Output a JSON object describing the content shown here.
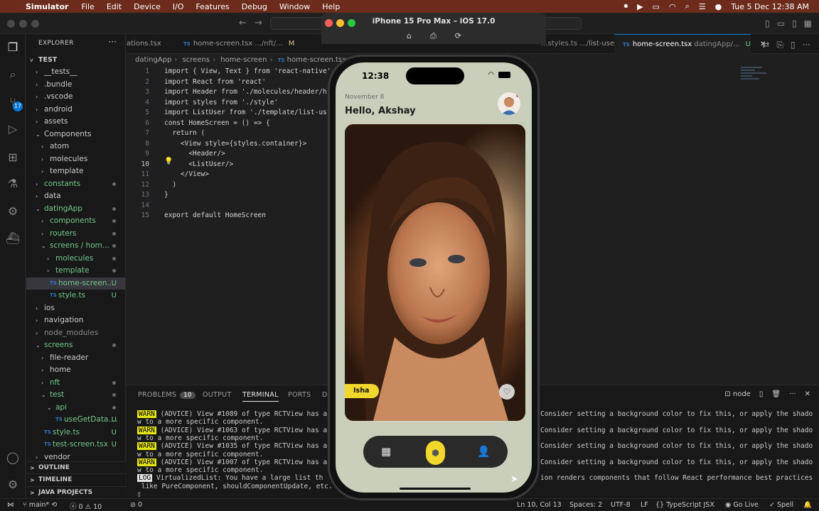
{
  "mac_menubar": {
    "app": "Simulator",
    "menus": [
      "File",
      "Edit",
      "Device",
      "I/O",
      "Features",
      "Debug",
      "Window",
      "Help"
    ],
    "clock": "Tue 5 Dec  12:38 AM"
  },
  "simulator": {
    "title": "iPhone 15 Pro Max – iOS 17.0"
  },
  "explorer": {
    "header": "EXPLORER",
    "root": "TEST",
    "items": [
      {
        "label": "__tests__",
        "indent": 1,
        "chev": ">",
        "mark": ""
      },
      {
        "label": ".bundle",
        "indent": 1,
        "chev": ">",
        "mark": ""
      },
      {
        "label": ".vscode",
        "indent": 1,
        "chev": ">",
        "mark": ""
      },
      {
        "label": "android",
        "indent": 1,
        "chev": ">",
        "mark": ""
      },
      {
        "label": "assets",
        "indent": 1,
        "chev": ">",
        "mark": ""
      },
      {
        "label": "Components",
        "indent": 1,
        "chev": "v",
        "mark": ""
      },
      {
        "label": "atom",
        "indent": 2,
        "chev": ">",
        "mark": ""
      },
      {
        "label": "molecules",
        "indent": 2,
        "chev": ">",
        "mark": ""
      },
      {
        "label": "template",
        "indent": 2,
        "chev": ">",
        "mark": ""
      },
      {
        "label": "constants",
        "indent": 1,
        "chev": ">",
        "mark": "dot",
        "color": "#73c991"
      },
      {
        "label": "data",
        "indent": 1,
        "chev": ">",
        "mark": ""
      },
      {
        "label": "datingApp",
        "indent": 1,
        "chev": "v",
        "mark": "dot",
        "color": "#73c991"
      },
      {
        "label": "components",
        "indent": 2,
        "chev": ">",
        "mark": "dot",
        "color": "#73c991"
      },
      {
        "label": "routers",
        "indent": 2,
        "chev": ">",
        "mark": "dot",
        "color": "#73c991"
      },
      {
        "label": "screens / hom...",
        "indent": 2,
        "chev": "v",
        "mark": "dot",
        "color": "#73c991"
      },
      {
        "label": "molecules",
        "indent": 3,
        "chev": ">",
        "mark": "dot",
        "color": "#73c991"
      },
      {
        "label": "template",
        "indent": 3,
        "chev": ">",
        "mark": "dot",
        "color": "#73c991"
      },
      {
        "label": "home-screen...",
        "indent": 3,
        "chev": "",
        "ts": true,
        "mark": "U",
        "color": "#73c991",
        "selected": true
      },
      {
        "label": "style.ts",
        "indent": 3,
        "chev": "",
        "ts": true,
        "mark": "U",
        "color": "#73c991"
      },
      {
        "label": "ios",
        "indent": 1,
        "chev": ">",
        "mark": ""
      },
      {
        "label": "navigation",
        "indent": 1,
        "chev": ">",
        "mark": ""
      },
      {
        "label": "node_modules",
        "indent": 1,
        "chev": ">",
        "mark": "",
        "color": "#8c8c8c"
      },
      {
        "label": "screens",
        "indent": 1,
        "chev": "v",
        "mark": "dot",
        "color": "#73c991"
      },
      {
        "label": "file-reader",
        "indent": 2,
        "chev": ">",
        "mark": ""
      },
      {
        "label": "home",
        "indent": 2,
        "chev": ">",
        "mark": ""
      },
      {
        "label": "nft",
        "indent": 2,
        "chev": ">",
        "mark": "dot",
        "color": "#73c991"
      },
      {
        "label": "test",
        "indent": 2,
        "chev": "v",
        "mark": "dot",
        "color": "#73c991"
      },
      {
        "label": "api",
        "indent": 3,
        "chev": "v",
        "mark": "dot",
        "color": "#73c991"
      },
      {
        "label": "useGetData....",
        "indent": 4,
        "chev": "",
        "ts": true,
        "mark": "U",
        "color": "#73c991"
      },
      {
        "label": "style.ts",
        "indent": 2,
        "chev": "",
        "ts": true,
        "mark": "U",
        "color": "#73c991"
      },
      {
        "label": "test-screen.tsx",
        "indent": 2,
        "chev": "",
        "ts": true,
        "mark": "U",
        "color": "#73c991"
      },
      {
        "label": "vendor",
        "indent": 1,
        "chev": ">",
        "mark": ""
      }
    ],
    "outline": "OUTLINE",
    "timeline": "TIMELINE",
    "java": "JAVA PROJECTS"
  },
  "tabs": [
    {
      "name": "ations.tsx",
      "sub": "",
      "mod": "",
      "ts": false,
      "active": false
    },
    {
      "name": "home-screen.tsx",
      "sub": ".../nft/...",
      "mod": "M",
      "ts": true,
      "active": false
    },
    {
      "name": "list-users",
      "sub": "",
      "mod": "U",
      "ts": false,
      "active": false,
      "pre": "...styles.ts .../"
    },
    {
      "name": "home-screen.tsx",
      "sub": "datingApp/...",
      "mod": "U",
      "ts": true,
      "active": true
    }
  ],
  "breadcrumb": [
    "datingApp",
    "screens",
    "home-screen",
    "home-screen.tsx"
  ],
  "code_lines": [
    "import { View, Text } from 'react-native'",
    "import React from 'react'",
    "import Header from './molecules/header/h",
    "import styles from './style'",
    "import ListUser from './template/list-us",
    "const HomeScreen = () => {",
    "  return (",
    "    <View style={styles.container}>",
    "      <Header/>",
    "      <ListUser/>",
    "    </View>",
    "  )",
    "}",
    "",
    "export default HomeScreen"
  ],
  "panel": {
    "tabs": [
      "PROBLEMS",
      "OUTPUT",
      "TERMINAL",
      "PORTS",
      "D"
    ],
    "problems_count": "10",
    "active": "TERMINAL",
    "shell": "node",
    "lines": [
      {
        "tag": "WARN",
        "text": " (ADVICE) View #1089 of type RCTView has a"
      },
      {
        "tag": "",
        "text": "w to a more specific component."
      },
      {
        "tag": "WARN",
        "text": " (ADVICE) View #1063 of type RCTView has a"
      },
      {
        "tag": "",
        "text": "w to a more specific component."
      },
      {
        "tag": "WARN",
        "text": " (ADVICE) View #1035 of type RCTView has a"
      },
      {
        "tag": "",
        "text": "w to a more specific component."
      },
      {
        "tag": "WARN",
        "text": " (ADVICE) View #1007 of type RCTView has a"
      },
      {
        "tag": "",
        "text": "w to a more specific component."
      },
      {
        "tag": "LOG",
        "text": " VirtualizedList: You have a large list th"
      },
      {
        "tag": "",
        "text": " like PureComponent, shouldComponentUpdate, etc."
      },
      {
        "tag": "",
        "text": "▯"
      }
    ],
    "right_lines": [
      "Consider setting a background color to fix this, or apply the shado",
      "Consider setting a background color to fix this, or apply the shado",
      "Consider setting a background color to fix this, or apply the shado",
      "Consider setting a background color to fix this, or apply the shado",
      "ion renders components that follow React performance best practices"
    ]
  },
  "status": {
    "branch": "main*",
    "sync": "⟲",
    "errors": "0",
    "warnings": "10",
    "ports": "0",
    "position": "Ln 10, Col 13",
    "spaces": "Spaces: 2",
    "encoding": "UTF-8",
    "eol": "LF",
    "language": "TypeScript JSX",
    "golive": "Go Live",
    "spell": "Spell"
  },
  "phone": {
    "time": "12:38",
    "date": "November 8",
    "greeting": "Hello, Akshay",
    "card_name": "Isha"
  },
  "colors": {
    "accent_yellow": "#f2d82c",
    "app_bg": "#c9cfba",
    "vscode_blue": "#0078d4",
    "untracked_green": "#73c991"
  }
}
